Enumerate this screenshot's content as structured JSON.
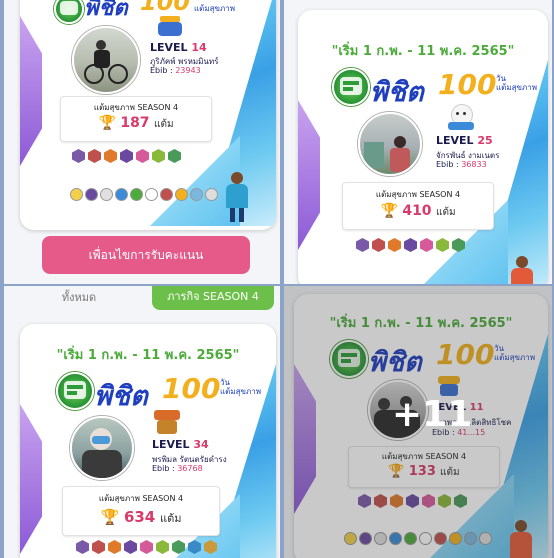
{
  "colors": {
    "accent_pink": "#e55a88",
    "accent_green": "#4cab3a",
    "brand_blue": "#1f3fbf",
    "gold": "#f2b01e",
    "value_red": "#d93a6a"
  },
  "cards": [
    {
      "date_range": "",
      "brand": "พิชิต",
      "hundred": "100",
      "brand_sub_1": "วัน",
      "brand_sub_2": "แต้มสุขภาพ",
      "level_label": "LEVEL",
      "level": "14",
      "name": "ภูริภัคพ์ พรหมมินทร์",
      "ebib_label": "Ebib :",
      "ebib": "23943",
      "season_label": "แต้มสุขภาพ SEASON 4",
      "score": "187",
      "unit": "แต้ม"
    },
    {
      "date_range": "\"เริ่ม 1 ก.พ. - 11 พ.ค. 2565\"",
      "brand": "พิชิต",
      "hundred": "100",
      "brand_sub_1": "วัน",
      "brand_sub_2": "แต้มสุขภาพ",
      "level_label": "LEVEL",
      "level": "25",
      "name": "จักรพันธ์ งามเนตร",
      "ebib_label": "Ebib :",
      "ebib": "36833",
      "season_label": "แต้มสุขภาพ SEASON 4",
      "score": "410",
      "unit": "แต้ม"
    },
    {
      "date_range": "\"เริ่ม 1 ก.พ. - 11 พ.ค. 2565\"",
      "brand": "พิชิต",
      "hundred": "100",
      "brand_sub_1": "วัน",
      "brand_sub_2": "แต้มสุขภาพ",
      "level_label": "LEVEL",
      "level": "34",
      "name": "พรพิมล รัตนตรัยดำรง",
      "ebib_label": "Ebib :",
      "ebib": "36768",
      "season_label": "แต้มสุขภาพ SEASON 4",
      "score": "634",
      "unit": "แต้ม"
    },
    {
      "date_range": "\"เริ่ม 1 ก.พ. - 11 พ.ค. 2565\"",
      "brand": "พิชิต",
      "hundred": "100",
      "brand_sub_1": "วัน",
      "brand_sub_2": "แต้มสุขภาพ",
      "level_label": "LEVEL",
      "level": "11",
      "name": "ธนาพล ไ...ลิตสิทธิโชค",
      "ebib_label": "Ebib :",
      "ebib": "41...15",
      "season_label": "แต้มสุขภาพ SEASON 4",
      "score": "133",
      "unit": "แต้ม"
    }
  ],
  "actions": {
    "pink_button": "เพื่อนไขการรับคะแนน",
    "tab_all": "ทั้งหมด",
    "tab_mission": "ภารกิจ SEASON 4"
  },
  "overlay": {
    "more_count": "+11"
  }
}
